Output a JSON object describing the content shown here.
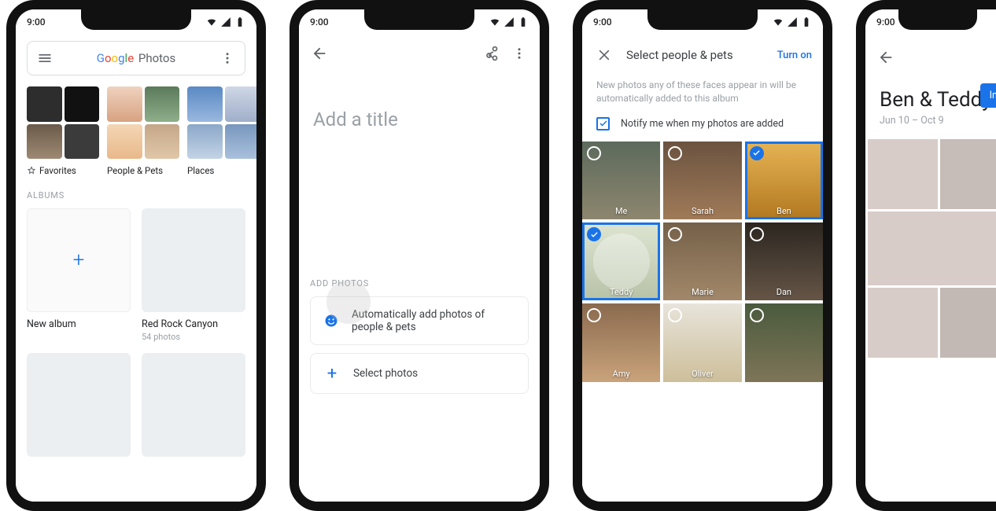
{
  "status": {
    "time": "9:00"
  },
  "phone1": {
    "app_name_plain": "Photos",
    "categories": {
      "favorites": "Favorites",
      "people_pets": "People & Pets",
      "places": "Places"
    },
    "section_albums": "ALBUMS",
    "new_album": "New album",
    "album1": {
      "title": "Red Rock Canyon",
      "subtitle": "54 photos"
    }
  },
  "phone2": {
    "title_placeholder": "Add a title",
    "section": "ADD PHOTOS",
    "opt_auto": "Automatically add photos of people & pets",
    "opt_select": "Select photos"
  },
  "phone3": {
    "title": "Select people & pets",
    "action": "Turn on",
    "desc": "New photos any of these faces appear in will be automatically added to this album",
    "notify": "Notify me when my photos are added",
    "faces": [
      {
        "name": "Me",
        "selected": false
      },
      {
        "name": "Sarah",
        "selected": false
      },
      {
        "name": "Ben",
        "selected": true
      },
      {
        "name": "Teddy",
        "selected": true
      },
      {
        "name": "Marie",
        "selected": false
      },
      {
        "name": "Dan",
        "selected": false
      },
      {
        "name": "Amy",
        "selected": false
      },
      {
        "name": "Oliver",
        "selected": false
      },
      {
        "name": "",
        "selected": false
      }
    ]
  },
  "phone4": {
    "title": "Ben & Teddy",
    "subtitle": "Jun 10 – Oct 9",
    "invite": "Invi"
  }
}
